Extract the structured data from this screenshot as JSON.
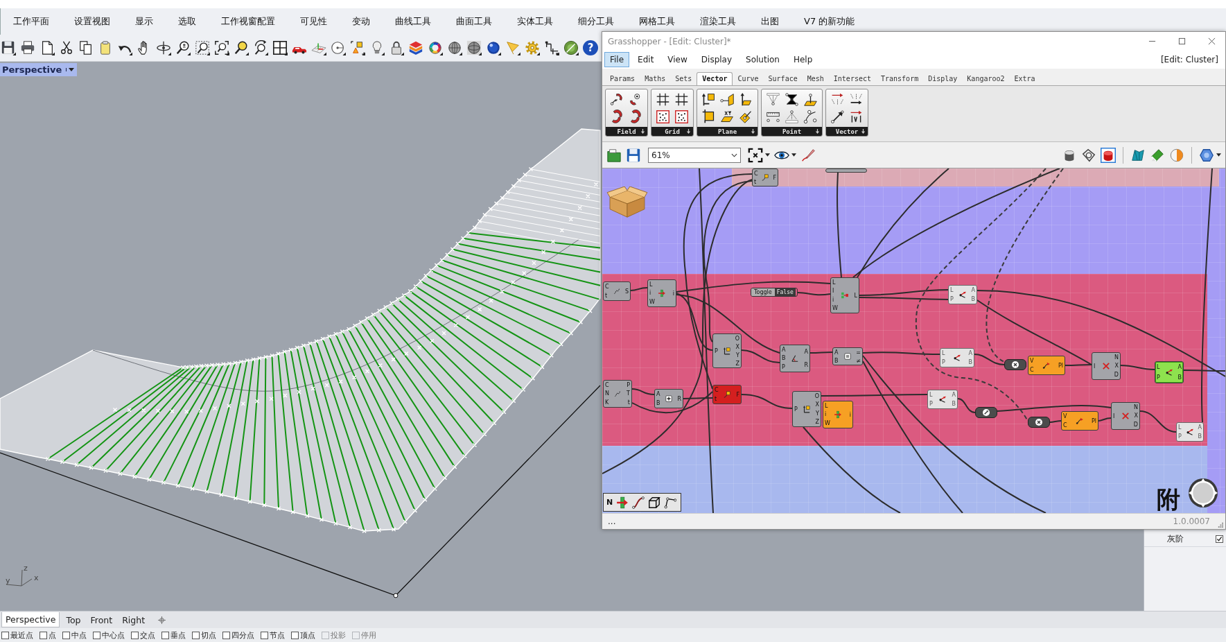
{
  "rhino": {
    "menu": [
      "工作平面",
      "设置视图",
      "显示",
      "选取",
      "工作视窗配置",
      "可见性",
      "变动",
      "曲线工具",
      "曲面工具",
      "实体工具",
      "细分工具",
      "网格工具",
      "渲染工具",
      "出图",
      "V7 的新功能"
    ],
    "toolbar": {
      "help_glyph": "?"
    },
    "viewport": {
      "title": "Perspective",
      "axes": [
        {
          "label": "z"
        },
        {
          "label": "x"
        },
        {
          "label": "y"
        }
      ]
    },
    "side_panel": {
      "label": "灰阶",
      "checked": true
    },
    "viewport_tabs": [
      {
        "label": "Perspective",
        "selected": true
      },
      {
        "label": "Top",
        "selected": false
      },
      {
        "label": "Front",
        "selected": false
      },
      {
        "label": "Right",
        "selected": false
      }
    ],
    "osnaps": [
      {
        "label": "最近点",
        "checked": false,
        "disabled": false
      },
      {
        "label": "点",
        "checked": false,
        "disabled": false
      },
      {
        "label": "中点",
        "checked": false,
        "disabled": false
      },
      {
        "label": "中心点",
        "checked": false,
        "disabled": false
      },
      {
        "label": "交点",
        "checked": false,
        "disabled": false
      },
      {
        "label": "垂点",
        "checked": false,
        "disabled": false
      },
      {
        "label": "切点",
        "checked": false,
        "disabled": false
      },
      {
        "label": "四分点",
        "checked": false,
        "disabled": false
      },
      {
        "label": "节点",
        "checked": false,
        "disabled": false
      },
      {
        "label": "顶点",
        "checked": false,
        "disabled": false
      },
      {
        "label": "投影",
        "checked": false,
        "disabled": true
      },
      {
        "label": "停用",
        "checked": false,
        "disabled": true
      }
    ]
  },
  "grasshopper": {
    "window": {
      "title": "Grasshopper - [Edit: Cluster]*"
    },
    "menu": [
      {
        "label": "File",
        "selected": true
      },
      {
        "label": "Edit",
        "selected": false
      },
      {
        "label": "View",
        "selected": false
      },
      {
        "label": "Display",
        "selected": false
      },
      {
        "label": "Solution",
        "selected": false
      },
      {
        "label": "Help",
        "selected": false
      }
    ],
    "document_label": "[Edit: Cluster]",
    "tabs": [
      {
        "label": "Params",
        "selected": false
      },
      {
        "label": "Maths",
        "selected": false
      },
      {
        "label": "Sets",
        "selected": false
      },
      {
        "label": "Vector",
        "selected": true
      },
      {
        "label": "Curve",
        "selected": false
      },
      {
        "label": "Surface",
        "selected": false
      },
      {
        "label": "Mesh",
        "selected": false
      },
      {
        "label": "Intersect",
        "selected": false
      },
      {
        "label": "Transform",
        "selected": false
      },
      {
        "label": "Display",
        "selected": false
      },
      {
        "label": "Kangaroo2",
        "selected": false
      },
      {
        "label": "Extra",
        "selected": false
      }
    ],
    "ribbon_panels": [
      "Field",
      "Grid",
      "Plane",
      "Point",
      "Vector"
    ],
    "zoom_field": {
      "value": "61%"
    },
    "canvas": {
      "groups": [
        {
          "color": "#dcaab5"
        },
        {
          "color": "#db5a80"
        },
        {
          "color": "#a8b8ee"
        }
      ],
      "nodes": [
        {
          "kind": "component",
          "selected": false,
          "disabled": false,
          "warning": false,
          "error": false,
          "inputs": [
            "C",
            "t"
          ],
          "outputs": [
            "F"
          ]
        },
        {
          "kind": "component",
          "selected": false,
          "disabled": false,
          "warning": false,
          "error": false
        },
        {
          "kind": "component",
          "selected": false,
          "disabled": false,
          "warning": false,
          "error": false,
          "inputs": [
            "C",
            "t"
          ],
          "outputs": [
            "S"
          ]
        },
        {
          "kind": "component",
          "selected": false,
          "disabled": false,
          "warning": false,
          "error": false,
          "inputs": [
            "L",
            "i",
            "W"
          ],
          "outputs": [
            "i"
          ]
        },
        {
          "kind": "toggle",
          "selected": false,
          "label": "Toggle",
          "value": "False"
        },
        {
          "kind": "component",
          "selected": false,
          "disabled": false,
          "warning": false,
          "error": false,
          "inputs": [
            "L",
            "I",
            "i",
            "W"
          ],
          "outputs": [
            "L"
          ]
        },
        {
          "kind": "component",
          "selected": false,
          "disabled": true,
          "warning": false,
          "error": false,
          "inputs": [
            "L",
            "P"
          ],
          "outputs": [
            "A",
            "B"
          ]
        },
        {
          "kind": "component",
          "selected": false,
          "disabled": false,
          "warning": false,
          "error": false,
          "inputs": [
            "P"
          ],
          "outputs": [
            "O",
            "X",
            "Y",
            "Z"
          ]
        },
        {
          "kind": "component",
          "selected": false,
          "disabled": false,
          "warning": false,
          "error": false,
          "inputs": [
            "A",
            "B",
            "P"
          ],
          "outputs": [
            "A",
            "R"
          ]
        },
        {
          "kind": "component",
          "selected": false,
          "disabled": false,
          "warning": false,
          "error": false,
          "inputs": [
            "A",
            "B"
          ],
          "outputs": [
            "=",
            "≠"
          ]
        },
        {
          "kind": "component",
          "selected": false,
          "disabled": true,
          "warning": false,
          "error": false,
          "inputs": [
            "L",
            "P"
          ],
          "outputs": [
            "A",
            "B"
          ]
        },
        {
          "kind": "operator",
          "selected": false
        },
        {
          "kind": "component",
          "selected": false,
          "disabled": false,
          "warning": true,
          "error": false,
          "inputs": [
            "V",
            "C"
          ],
          "outputs": [
            "Pl"
          ]
        },
        {
          "kind": "component",
          "selected": false,
          "disabled": false,
          "warning": false,
          "error": false,
          "inputs": [
            "I"
          ],
          "outputs": [
            "N",
            "X",
            "D"
          ]
        },
        {
          "kind": "component",
          "selected": true,
          "disabled": false,
          "warning": false,
          "error": false,
          "inputs": [
            "L",
            "P"
          ],
          "outputs": [
            "A",
            "B"
          ]
        },
        {
          "kind": "component",
          "selected": false,
          "disabled": false,
          "warning": false,
          "error": false,
          "inputs": [
            "C",
            "N",
            "K"
          ],
          "outputs": [
            "P",
            "T",
            "t"
          ]
        },
        {
          "kind": "component",
          "selected": false,
          "disabled": false,
          "warning": false,
          "error": false,
          "inputs": [
            "A",
            "B"
          ],
          "outputs": [
            "R"
          ]
        },
        {
          "kind": "component",
          "selected": false,
          "disabled": false,
          "warning": false,
          "error": true,
          "inputs": [
            "C",
            "t"
          ],
          "outputs": [
            "F"
          ]
        },
        {
          "kind": "component",
          "selected": false,
          "disabled": false,
          "warning": false,
          "error": false,
          "inputs": [
            "P"
          ],
          "outputs": [
            "O",
            "X",
            "Y",
            "Z"
          ]
        },
        {
          "kind": "component",
          "selected": false,
          "disabled": false,
          "warning": true,
          "error": false,
          "inputs": [
            "L",
            "i",
            "W"
          ],
          "outputs": [
            "i"
          ]
        },
        {
          "kind": "component",
          "selected": false,
          "disabled": true,
          "warning": false,
          "error": false,
          "inputs": [
            "L",
            "P"
          ],
          "outputs": [
            "A",
            "B"
          ]
        },
        {
          "kind": "operator",
          "selected": false
        },
        {
          "kind": "operator",
          "selected": false
        },
        {
          "kind": "component",
          "selected": false,
          "disabled": false,
          "warning": true,
          "error": false,
          "inputs": [
            "V",
            "C"
          ],
          "outputs": [
            "Pl"
          ]
        },
        {
          "kind": "component",
          "selected": false,
          "disabled": false,
          "warning": false,
          "error": false,
          "inputs": [
            "I"
          ],
          "outputs": [
            "N",
            "X",
            "D"
          ]
        },
        {
          "kind": "component",
          "selected": false,
          "disabled": true,
          "warning": false,
          "error": false,
          "inputs": [
            "L",
            "P"
          ],
          "outputs": [
            "A",
            "B"
          ]
        }
      ],
      "widget_label": "N",
      "text": "附"
    },
    "status_bar": {
      "left": "...",
      "version": "1.0.0007"
    }
  }
}
